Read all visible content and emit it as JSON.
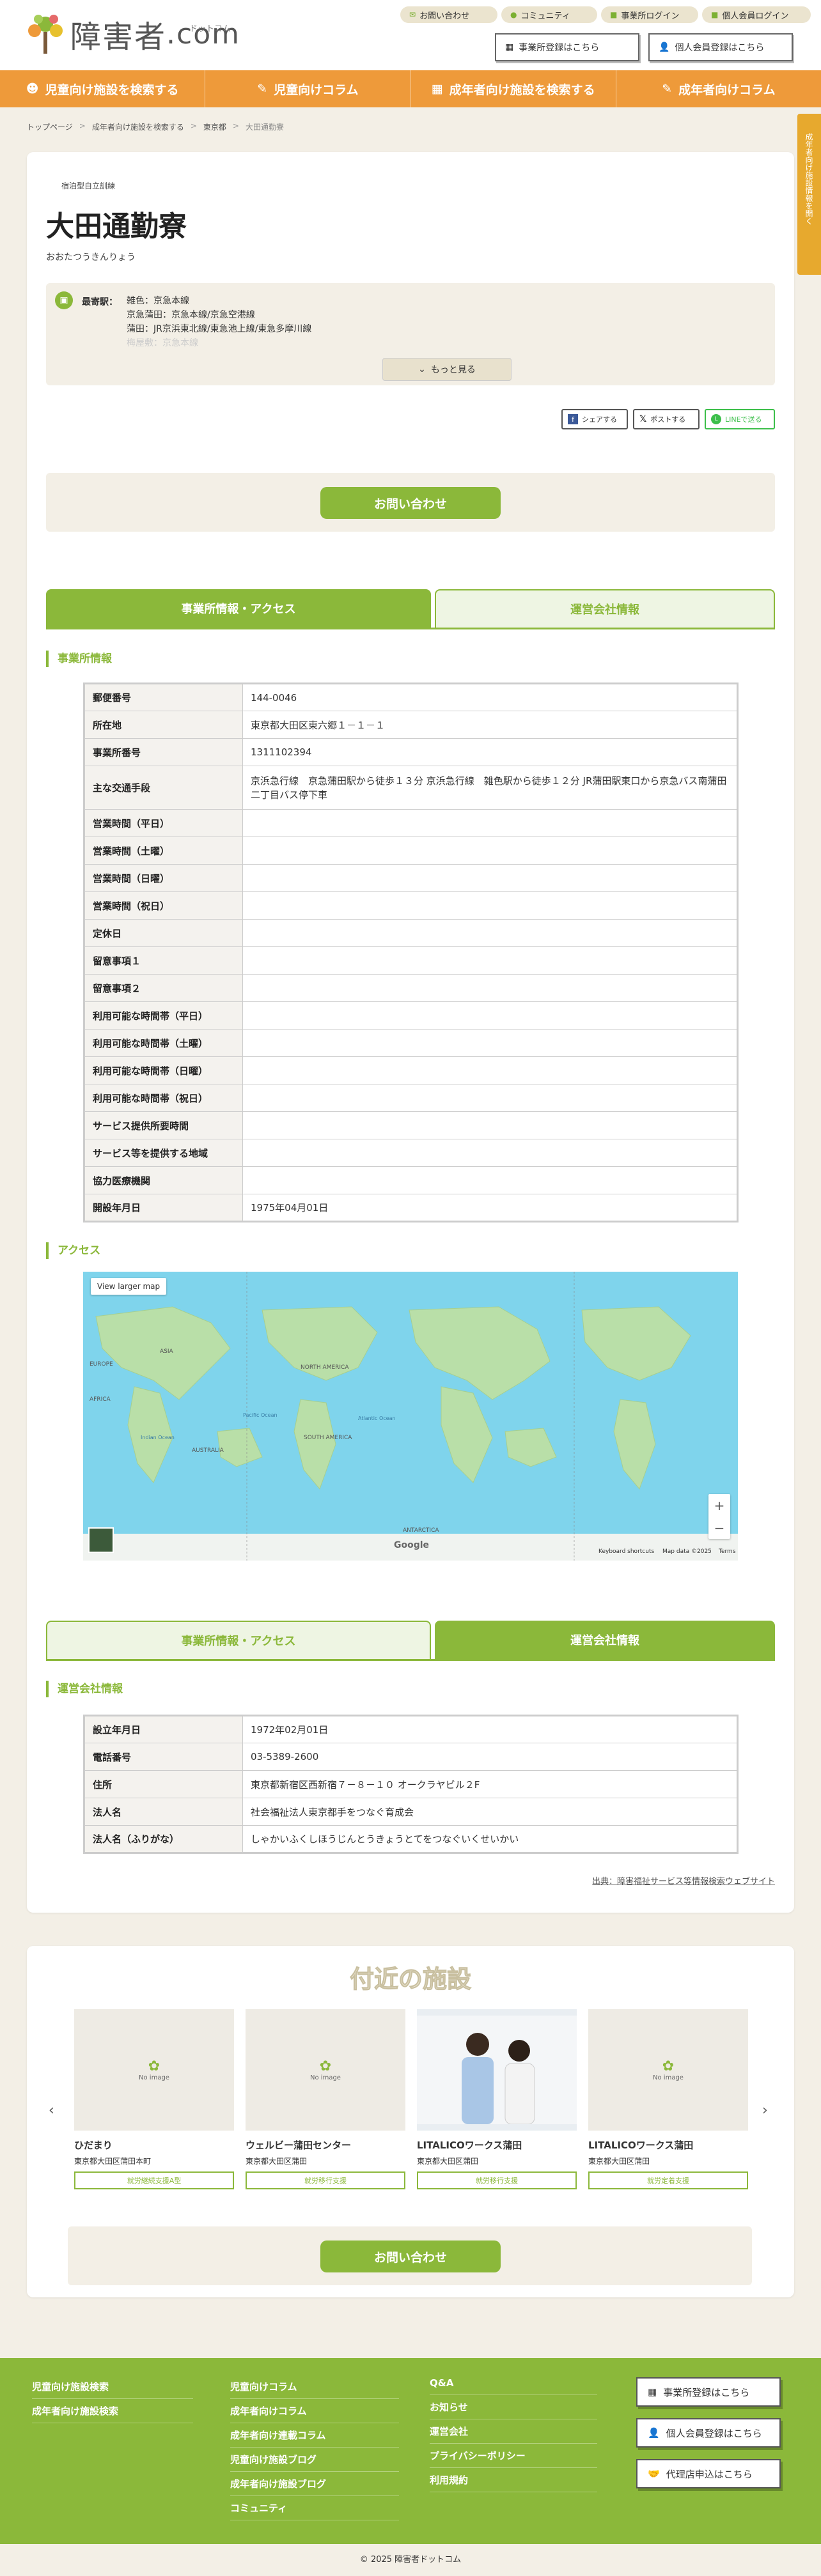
{
  "header": {
    "logo_text": "障害者",
    "logo_suffix": ".com",
    "logo_ruby": "ドットコム",
    "top_links": [
      {
        "label": "お問い合わせ",
        "icon": "mail-icon"
      },
      {
        "label": "コミュニティ",
        "icon": "chat-icon"
      },
      {
        "label": "事業所ログイン",
        "icon": "lock-icon"
      },
      {
        "label": "個人会員ログイン",
        "icon": "lock-icon"
      }
    ],
    "register_office": "事業所登録はこちら",
    "register_personal": "個人会員登録はこちら"
  },
  "nav": [
    {
      "label": "児童向け施設を検索する",
      "icon": "child-icon"
    },
    {
      "label": "児童向けコラム",
      "icon": "pencil-icon"
    },
    {
      "label": "成年者向け施設を検索する",
      "icon": "building-icon"
    },
    {
      "label": "成年者向けコラム",
      "icon": "pencil-icon"
    }
  ],
  "breadcrumb": [
    "トップページ",
    "成年者向け施設を検索する",
    "東京都",
    "大田通勤寮"
  ],
  "side_tab": "成年者向け施設情報を開く",
  "facility": {
    "category": "宿泊型自立訓練",
    "name": "大田通勤寮",
    "kana": "おおたつうきんりょう",
    "station_label": "最寄駅：",
    "stations": [
      "雑色：京急本線",
      "京急蒲田：京急本線/京急空港線",
      "蒲田：JR京浜東北線/東急池上線/東急多摩川線",
      "梅屋敷：京急本線"
    ],
    "more_label": "もっと見る"
  },
  "share": {
    "facebook": "シェアする",
    "x": "ポストする",
    "line": "LINEで送る"
  },
  "contact_label": "お問い合わせ",
  "tabs": {
    "office": "事業所情報・アクセス",
    "company": "運営会社情報"
  },
  "office_section": "事業所情報",
  "office_rows": [
    {
      "k": "郵便番号",
      "v": "144-0046"
    },
    {
      "k": "所在地",
      "v": "東京都大田区東六郷１－１－１"
    },
    {
      "k": "事業所番号",
      "v": "1311102394"
    },
    {
      "k": "主な交通手段",
      "v": "京浜急行線　京急蒲田駅から徒歩１３分 京浜急行線　雑色駅から徒歩１２分 JR蒲田駅東口から京急バス南蒲田二丁目バス停下車"
    },
    {
      "k": "営業時間（平日）",
      "v": ""
    },
    {
      "k": "営業時間（土曜）",
      "v": ""
    },
    {
      "k": "営業時間（日曜）",
      "v": ""
    },
    {
      "k": "営業時間（祝日）",
      "v": ""
    },
    {
      "k": "定休日",
      "v": ""
    },
    {
      "k": "留意事項１",
      "v": ""
    },
    {
      "k": "留意事項２",
      "v": ""
    },
    {
      "k": "利用可能な時間帯（平日）",
      "v": ""
    },
    {
      "k": "利用可能な時間帯（土曜）",
      "v": ""
    },
    {
      "k": "利用可能な時間帯（日曜）",
      "v": ""
    },
    {
      "k": "利用可能な時間帯（祝日）",
      "v": ""
    },
    {
      "k": "サービス提供所要時間",
      "v": ""
    },
    {
      "k": "サービス等を提供する地域",
      "v": ""
    },
    {
      "k": "協力医療機関",
      "v": ""
    },
    {
      "k": "開設年月日",
      "v": "1975年04月01日"
    }
  ],
  "access_section": "アクセス",
  "map": {
    "view_larger": "View larger map",
    "footer": [
      "Keyboard shortcuts",
      "Map data ©2025",
      "Terms"
    ],
    "brand": "Google",
    "labels": [
      "ASIA",
      "EUROPE",
      "AFRICA",
      "NORTH AMERICA",
      "SOUTH AMERICA",
      "AUSTRALIA",
      "ANTARCTICA",
      "Indian Ocean",
      "Pacific Ocean",
      "Atlantic Ocean"
    ]
  },
  "company_section": "運営会社情報",
  "company_rows": [
    {
      "k": "設立年月日",
      "v": "1972年02月01日"
    },
    {
      "k": "電話番号",
      "v": "03-5389-2600"
    },
    {
      "k": "住所",
      "v": "東京都新宿区西新宿７－８－１０ オークラヤビル２F"
    },
    {
      "k": "法人名",
      "v": "社会福祉法人東京都手をつなぐ育成会"
    },
    {
      "k": "法人名（ふりがな）",
      "v": "しゃかいふくしほうじんとうきょうとてをつなぐいくせいかい"
    }
  ],
  "source": "出典：障害福祉サービス等情報検索ウェブサイト",
  "nearby_title": "付近の施設",
  "nearby": [
    {
      "name": "ひだまり",
      "addr": "東京都大田区蒲田本町",
      "tag": "就労継続支援A型",
      "img": "No image"
    },
    {
      "name": "ウェルビー蒲田センター",
      "addr": "東京都大田区蒲田",
      "tag": "就労移行支援",
      "img": "No image"
    },
    {
      "name": "LITALICOワークス蒲田",
      "addr": "東京都大田区蒲田",
      "tag": "就労移行支援",
      "img": ""
    },
    {
      "name": "LITALICOワークス蒲田",
      "addr": "東京都大田区蒲田",
      "tag": "就労定着支援",
      "img": "No image"
    }
  ],
  "footer": {
    "col1": [
      "児童向け施設検索",
      "成年者向け施設検索"
    ],
    "col2": [
      "児童向けコラム",
      "成年者向けコラム",
      "成年者向け連載コラム",
      "児童向け施設ブログ",
      "成年者向け施設ブログ",
      "コミュニティ"
    ],
    "col3": [
      "Q&A",
      "お知らせ",
      "運営会社",
      "プライバシーポリシー",
      "利用規約"
    ],
    "buttons": [
      "事業所登録はこちら",
      "個人会員登録はこちら",
      "代理店申込はこちら"
    ]
  },
  "copyright": "© 2025 障害者ドットコム",
  "colors": {
    "green": "#8bb83a",
    "orange": "#ee9a3a",
    "beige": "#f3efe6",
    "tab_yellow": "#e7a92e"
  }
}
